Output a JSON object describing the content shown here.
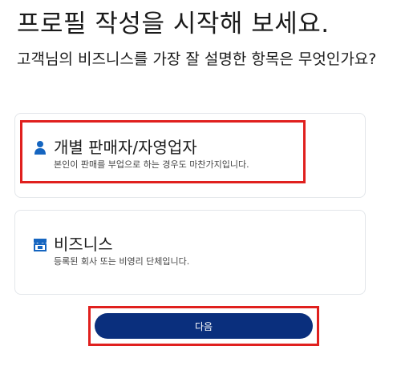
{
  "header": {
    "title": "프로필 작성을 시작해 보세요.",
    "subtitle": "고객님의 비즈니스를 가장 잘 설명한 항목은 무엇인가요?"
  },
  "options": [
    {
      "icon": "person-icon",
      "title": "개별 판매자/자영업자",
      "description": "본인이 판매를 부업으로 하는 경우도 마찬가지입니다."
    },
    {
      "icon": "storefront-icon",
      "title": "비즈니스",
      "description": "등록된 회사 또는 비영리 단체입니다."
    }
  ],
  "actions": {
    "next_label": "다음"
  },
  "colors": {
    "accent": "#0a2f7d",
    "icon": "#1565c0",
    "highlight": "#e0201e",
    "card_border": "#e3e6ea"
  }
}
